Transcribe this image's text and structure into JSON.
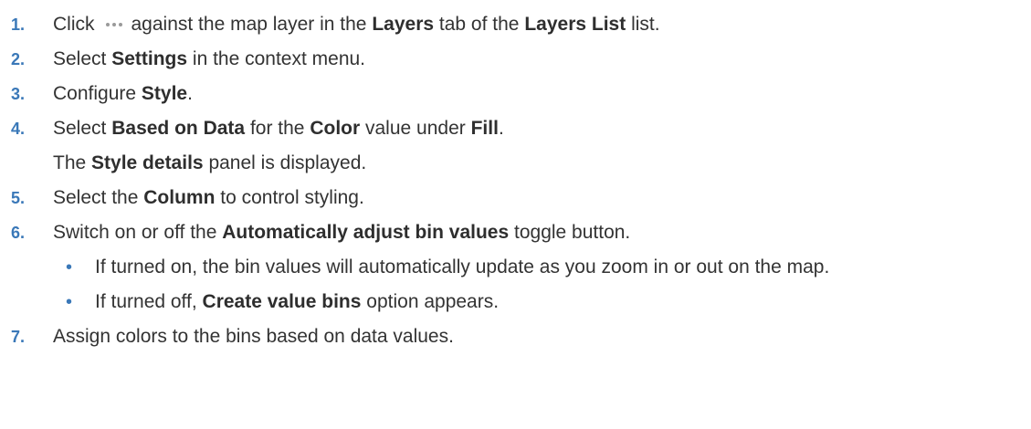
{
  "steps": [
    {
      "number": "1.",
      "t1": "Click",
      "icon": "ellipsis-icon",
      "t2": "against the map layer in the",
      "b1": "Layers",
      "t3": "tab of the",
      "b2": "Layers List",
      "t4": "list."
    },
    {
      "number": "2.",
      "t1": "Select",
      "b1": "Settings",
      "t2": "in the context menu."
    },
    {
      "number": "3.",
      "t1": "Configure",
      "b1": "Style",
      "t2": "."
    },
    {
      "number": "4.",
      "t1": "Select",
      "b1": "Based on Data",
      "t2": "for the",
      "b2": "Color",
      "t3": "value under",
      "b3": "Fill",
      "t4": ".",
      "note_t1": "The",
      "note_b1": "Style details",
      "note_t2": "panel is displayed."
    },
    {
      "number": "5.",
      "t1": "Select the",
      "b1": "Column",
      "t2": "to control styling."
    },
    {
      "number": "6.",
      "t1": "Switch on or off the",
      "b1": "Automatically adjust bin values",
      "t2": "toggle button.",
      "bullets": [
        {
          "marker": "•",
          "text": "If turned on, the bin values will automatically update as you zoom in or out on the map."
        },
        {
          "marker": "•",
          "t1": "If turned off,",
          "b1": "Create value bins",
          "t2": "option appears."
        }
      ]
    },
    {
      "number": "7.",
      "t1": "Assign colors to the bins based on data values."
    }
  ],
  "colors": {
    "text": "#333333",
    "number": "#3a78b8",
    "bullet": "#3a78b8",
    "icon": "#9a9a9a"
  }
}
